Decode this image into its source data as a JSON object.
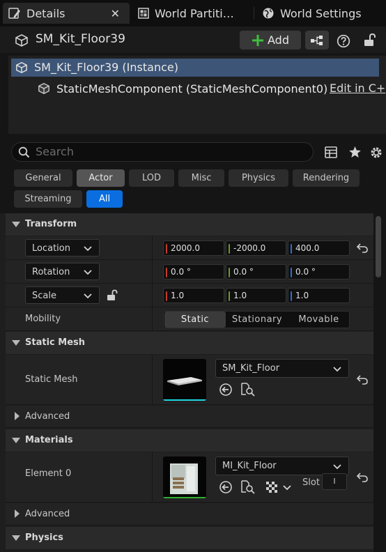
{
  "tabs": [
    {
      "label": "Details",
      "icon": "details-pencil-icon",
      "close": "✕"
    },
    {
      "label": "World Partiti…",
      "icon": "world-partition-icon"
    },
    {
      "label": "World Settings",
      "icon": "globe-icon"
    }
  ],
  "header": {
    "actor_name": "SM_Kit_Floor39",
    "add_label": "Add"
  },
  "components": {
    "root": "SM_Kit_Floor39 (Instance)",
    "child": "StaticMeshComponent (StaticMeshComponent0)",
    "edit_link": "Edit in C+"
  },
  "search": {
    "placeholder": "Search"
  },
  "filters": [
    {
      "label": "General",
      "state": "normal"
    },
    {
      "label": "Actor",
      "state": "selected"
    },
    {
      "label": "LOD",
      "state": "normal"
    },
    {
      "label": "Misc",
      "state": "normal"
    },
    {
      "label": "Physics",
      "state": "normal"
    },
    {
      "label": "Rendering",
      "state": "normal"
    },
    {
      "label": "Streaming",
      "state": "normal"
    },
    {
      "label": "All",
      "state": "active"
    }
  ],
  "transform": {
    "title": "Transform",
    "location": {
      "label": "Location",
      "x": "2000.0",
      "y": "-2000.0",
      "z": "400.0"
    },
    "rotation": {
      "label": "Rotation",
      "x": "0.0 °",
      "y": "0.0 °",
      "z": "0.0 °"
    },
    "scale": {
      "label": "Scale",
      "x": "1.0",
      "y": "1.0",
      "z": "1.0"
    },
    "mobility": {
      "label": "Mobility",
      "options": [
        "Static",
        "Stationary",
        "Movable"
      ],
      "selected": "Static"
    }
  },
  "static_mesh": {
    "title": "Static Mesh",
    "row_label": "Static Mesh",
    "asset": "SM_Kit_Floor",
    "advanced": "Advanced"
  },
  "materials": {
    "title": "Materials",
    "row_label": "Element 0",
    "asset": "MI_Kit_Floor",
    "slot_label": "Slot",
    "slot_value": "I",
    "advanced": "Advanced"
  },
  "physics": {
    "title": "Physics"
  },
  "colors": {
    "axis_x": "#c43a2e",
    "axis_y": "#6a9a2c",
    "axis_z": "#2f6fd0",
    "selection": "#3d5576",
    "accent": "#0a6ee0",
    "mesh_underline": "#1fd8e0",
    "material_underline": "#2fb02f"
  }
}
